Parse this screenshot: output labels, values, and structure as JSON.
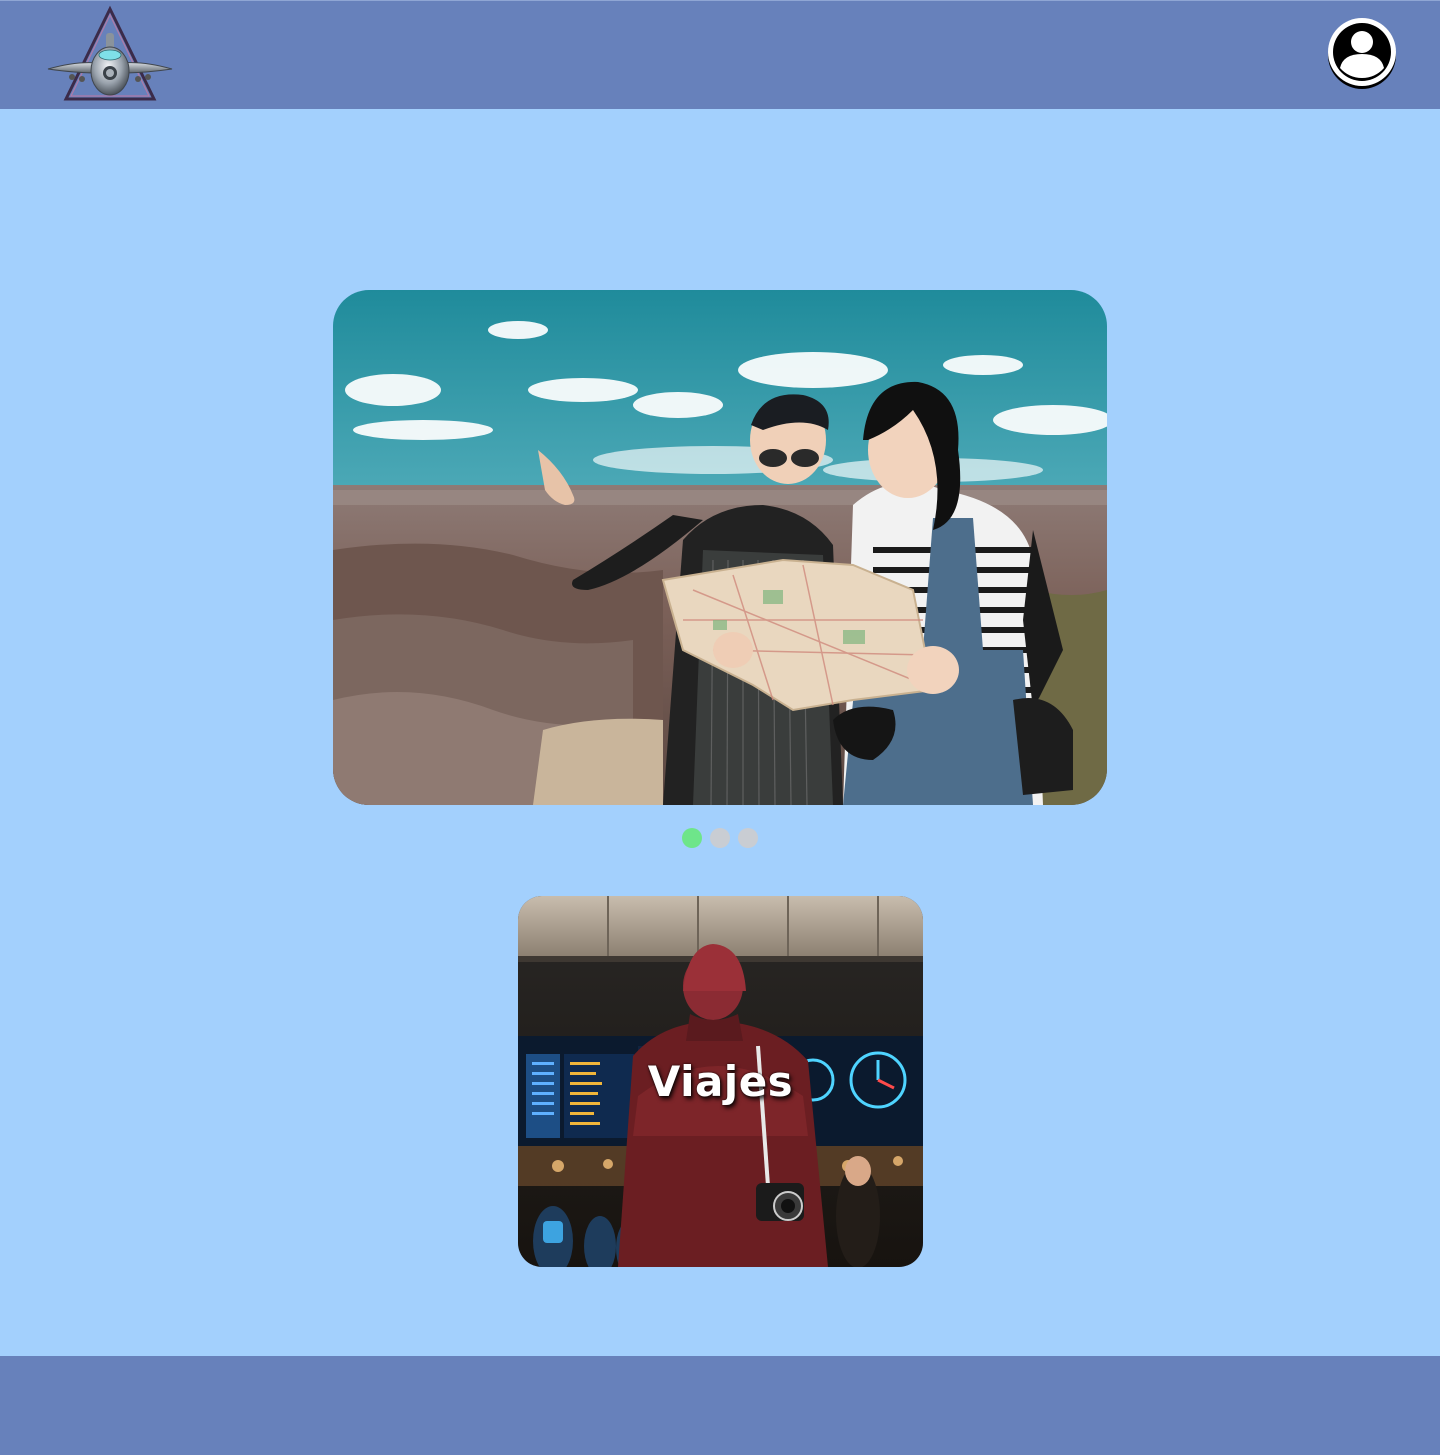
{
  "header": {
    "logo_icon": "airplane-triangle-logo",
    "profile_icon": "user-avatar-icon"
  },
  "carousel": {
    "slide_image": "travelers-with-map-at-canyon",
    "dots": [
      {
        "state": "active"
      },
      {
        "state": "inactive"
      },
      {
        "state": "inactive"
      }
    ],
    "active_index": 0,
    "colors": {
      "active": "#6ee58a",
      "inactive": "#c9cdd3"
    }
  },
  "category_card": {
    "title": "Viajes",
    "image": "traveler-at-airport-departures-board"
  },
  "colors": {
    "background": "#a3d0fd",
    "header": "#6781bb",
    "footer": "#6781bb"
  }
}
